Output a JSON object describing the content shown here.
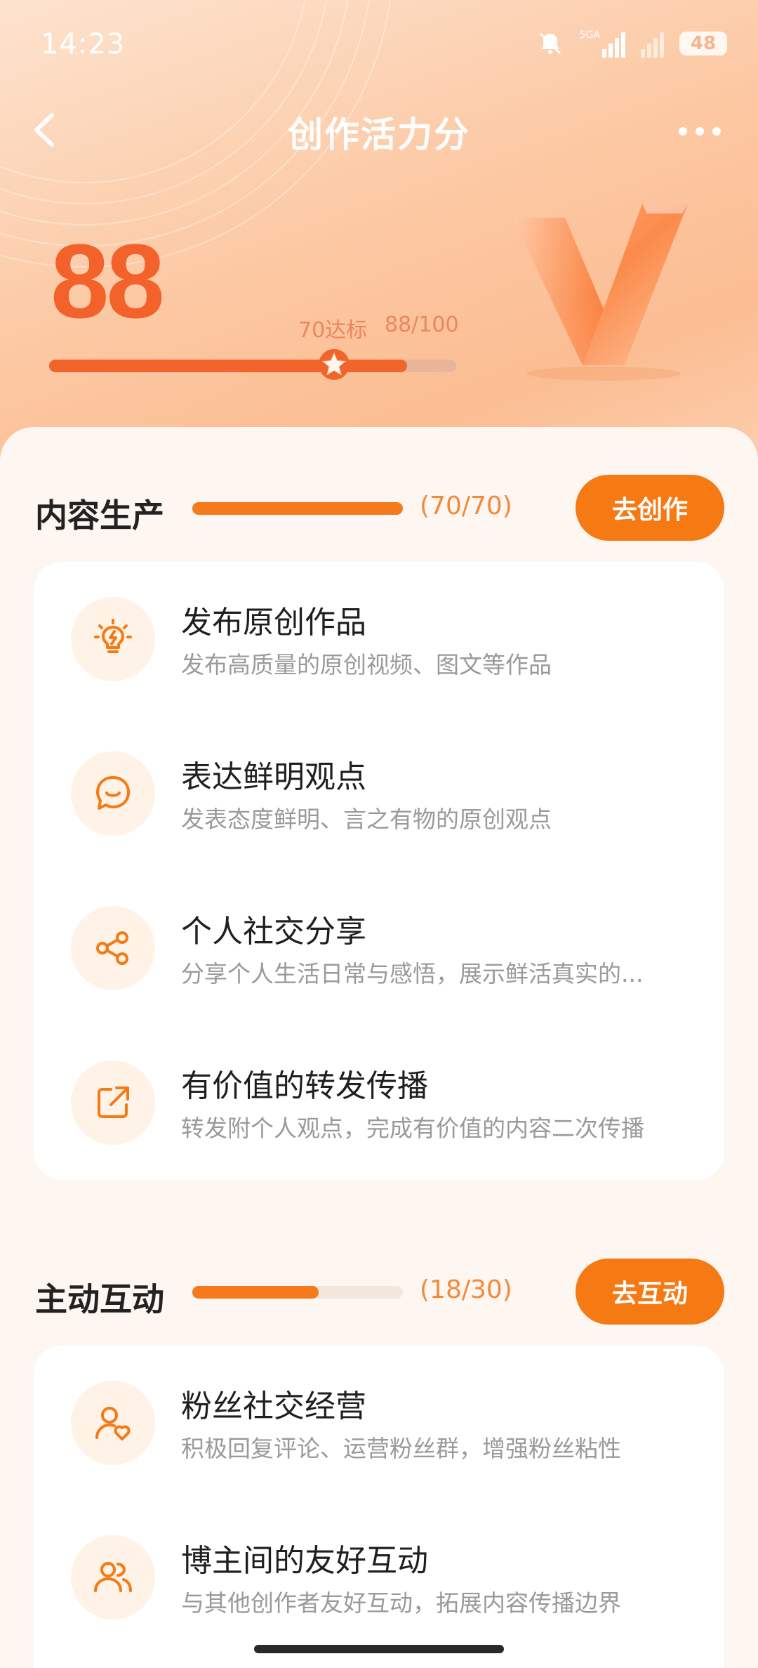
{
  "status_bar": {
    "time": "14:23",
    "signal_label": "5GA",
    "battery": "48"
  },
  "header": {
    "title": "创作活力分",
    "back_icon": "chevron-left-icon",
    "more_icon": "more-dots-icon"
  },
  "score": {
    "value": "88",
    "threshold_label": "70达标",
    "ratio_label": "88/100",
    "progress": 0.88,
    "threshold": 0.7
  },
  "sections": [
    {
      "title": "内容生产",
      "score_label": "(70/70)",
      "progress": 1.0,
      "button_label": "去创作",
      "items": [
        {
          "icon": "lightbulb-icon",
          "title": "发布原创作品",
          "desc": "发布高质量的原创视频、图文等作品"
        },
        {
          "icon": "chat-smile-icon",
          "title": "表达鲜明观点",
          "desc": "发表态度鲜明、言之有物的原创观点"
        },
        {
          "icon": "share-icon",
          "title": "个人社交分享",
          "desc": "分享个人生活日常与感悟，展示鲜活真实的..."
        },
        {
          "icon": "repost-icon",
          "title": "有价值的转发传播",
          "desc": "转发附个人观点，完成有价值的内容二次传播"
        }
      ]
    },
    {
      "title": "主动互动",
      "score_label": "(18/30)",
      "progress": 0.6,
      "button_label": "去互动",
      "items": [
        {
          "icon": "user-heart-icon",
          "title": "粉丝社交经营",
          "desc": "积极回复评论、运营粉丝群，增强粉丝粘性"
        },
        {
          "icon": "users-icon",
          "title": "博主间的友好互动",
          "desc": "与其他创作者友好互动，拓展内容传播边界"
        }
      ]
    }
  ],
  "colors": {
    "accent": "#f67a14",
    "score": "#f4622b",
    "icon_bg": "#fff2e6"
  }
}
